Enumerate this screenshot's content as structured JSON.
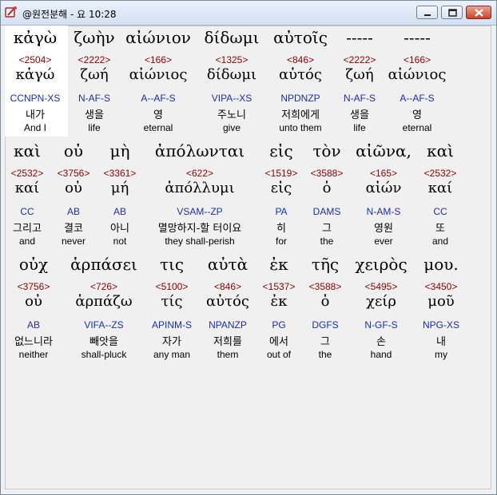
{
  "window": {
    "title": "@원전분해 - 요 10:28"
  },
  "rows": [
    {
      "words": [
        {
          "greek": "κἀγὼ",
          "strong": "<2504>",
          "lemma": "κἀγώ",
          "parsing": "CCNPN-XS",
          "korean": "내가",
          "english": "And I"
        },
        {
          "greek": "ζωὴν",
          "strong": "<2222>",
          "lemma": "ζωή",
          "parsing": "N-AF-S",
          "korean": "생을",
          "english": "life"
        },
        {
          "greek": "αἰώνιον",
          "strong": "<166>",
          "lemma": "αἰώνιος",
          "parsing": "A--AF-S",
          "korean": "영",
          "english": "eternal"
        },
        {
          "greek": "δίδωμι",
          "strong": "<1325>",
          "lemma": "δίδωμι",
          "parsing": "VIPA--XS",
          "korean": "주노니",
          "english": "give"
        },
        {
          "greek": "αὐτοῖς",
          "strong": "<846>",
          "lemma": "αὐτός",
          "parsing": "NPDNZP",
          "korean": "저희에게",
          "english": "unto them"
        },
        {
          "greek": "-----",
          "strong": "<2222>",
          "lemma": "ζωή",
          "parsing": "N-AF-S",
          "korean": "생을",
          "english": "life"
        },
        {
          "greek": "-----",
          "strong": "<166>",
          "lemma": "αἰώνιος",
          "parsing": "A--AF-S",
          "korean": "영",
          "english": "eternal"
        }
      ]
    },
    {
      "words": [
        {
          "greek": "καὶ",
          "strong": "<2532>",
          "lemma": "καί",
          "parsing": "CC",
          "korean": "그리고",
          "english": "and"
        },
        {
          "greek": "οὐ",
          "strong": "<3756>",
          "lemma": "οὐ",
          "parsing": "AB",
          "korean": "결코",
          "english": "never"
        },
        {
          "greek": "μὴ",
          "strong": "<3361>",
          "lemma": "μή",
          "parsing": "AB",
          "korean": "아니",
          "english": "not"
        },
        {
          "greek": "ἀπόλωνται",
          "strong": "<622>",
          "lemma": "ἀπόλλυμι",
          "parsing": "VSAM--ZP",
          "korean": "멸망하지-할 터이요",
          "english": "they shall-perish"
        },
        {
          "greek": "εἰς",
          "strong": "<1519>",
          "lemma": "εἰς",
          "parsing": "PA",
          "korean": "히",
          "english": "for"
        },
        {
          "greek": "τὸν",
          "strong": "<3588>",
          "lemma": "ὁ",
          "parsing": "DAMS",
          "korean": "그",
          "english": "the"
        },
        {
          "greek": "αἰῶνα,",
          "strong": "<165>",
          "lemma": "αἰών",
          "parsing": "N-AM-S",
          "korean": "영원",
          "english": "ever"
        },
        {
          "greek": "καὶ",
          "strong": "<2532>",
          "lemma": "καί",
          "parsing": "CC",
          "korean": "또",
          "english": "and"
        }
      ]
    },
    {
      "words": [
        {
          "greek": "οὐχ",
          "strong": "<3756>",
          "lemma": "οὐ",
          "parsing": "AB",
          "korean": "없느니라",
          "english": "neither"
        },
        {
          "greek": "ἁρπάσει",
          "strong": "<726>",
          "lemma": "ἁρπάζω",
          "parsing": "VIFA--ZS",
          "korean": "빼앗을",
          "english": "shall-pluck"
        },
        {
          "greek": "τις",
          "strong": "<5100>",
          "lemma": "τίς",
          "parsing": "APINM-S",
          "korean": "자가",
          "english": "any man"
        },
        {
          "greek": "αὐτὰ",
          "strong": "<846>",
          "lemma": "αὐτός",
          "parsing": "NPANZP",
          "korean": "저희를",
          "english": "them"
        },
        {
          "greek": "ἐκ",
          "strong": "<1537>",
          "lemma": "ἐκ",
          "parsing": "PG",
          "korean": "에서",
          "english": "out of"
        },
        {
          "greek": "τῆς",
          "strong": "<3588>",
          "lemma": "ὁ",
          "parsing": "DGFS",
          "korean": "그",
          "english": "the"
        },
        {
          "greek": "χειρὸς",
          "strong": "<5495>",
          "lemma": "χείρ",
          "parsing": "N-GF-S",
          "korean": "손",
          "english": "hand"
        },
        {
          "greek": "μου.",
          "strong": "<3450>",
          "lemma": "μοῦ",
          "parsing": "NPG-XS",
          "korean": "내",
          "english": "my"
        }
      ]
    }
  ],
  "colors": {
    "strong": "#8b0000",
    "parsing": "#1c2fa6",
    "highlight": "#ffffff"
  },
  "icons": {
    "app": "bible-app-icon",
    "minimize": "minimize-icon",
    "maximize": "maximize-icon",
    "close": "close-icon"
  }
}
